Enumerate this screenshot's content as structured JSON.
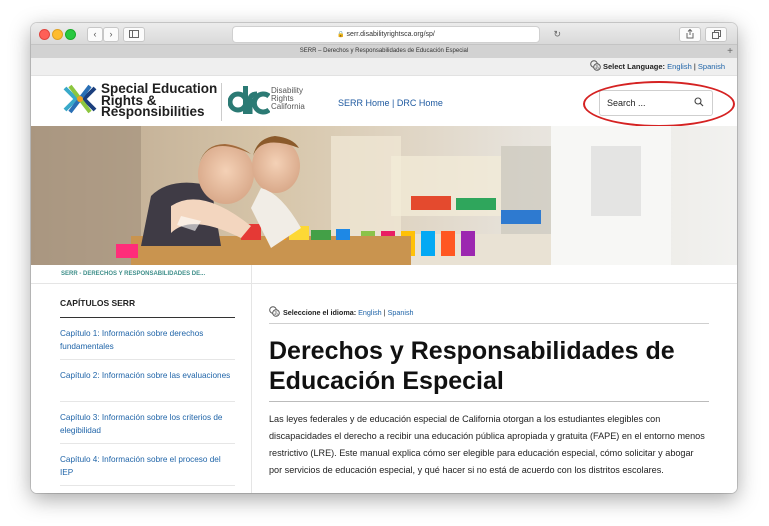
{
  "browser": {
    "url": "serr.disabilityrightsca.org/sp/",
    "tab_title": "SERR – Derechos y Responsabilidades de Educación Especial",
    "colors": {
      "close": "#fe5f57",
      "minimize": "#febc2e",
      "zoom": "#28c840"
    }
  },
  "lang_bar": {
    "label": "Select Language:",
    "english": "English",
    "sep": "|",
    "spanish": "Spanish"
  },
  "header": {
    "logo_line1": "Special Education",
    "logo_line2": "Rights &",
    "logo_line3": "Responsibilities",
    "drc_line1": "Disability",
    "drc_line2": "Rights",
    "drc_line3": "California",
    "nav_serr_home": "SERR Home",
    "nav_sep": "|",
    "nav_drc_home": "DRC Home",
    "search_placeholder": "Search ..."
  },
  "breadcrumb": "SERR - DERECHOS Y RESPONSABILIDADES DE...",
  "sidebar": {
    "title": "CAPÍTULOS SERR",
    "items": [
      {
        "label": "Capítulo 1: Información sobre derechos fundamentales"
      },
      {
        "label": "Capítulo 2: Información sobre las evaluaciones"
      },
      {
        "label": "Capítulo 3: Información sobre los criterios de elegibilidad"
      },
      {
        "label": "Capítulo 4: Información sobre el proceso del IEP"
      }
    ]
  },
  "main": {
    "lang_label": "Seleccione el idioma:",
    "lang_english": "English",
    "lang_sep": "|",
    "lang_spanish": "Spanish",
    "title": "Derechos y Responsabilidades de Educación Especial",
    "paragraph": "Las leyes federales y de educación especial de California otorgan a los estudiantes elegibles con discapacidades el derecho a recibir una educación pública apropiada y gratuita (FAPE) en el entorno menos restrictivo (LRE). Este manual explica cómo ser elegible para educación especial, cómo solicitar y abogar por servicios de educación especial, y qué hacer si no está de acuerdo con los distritos escolares."
  },
  "accent_colors": {
    "link": "#1f64a8",
    "highlight_oval": "#d52222",
    "breadcrumb": "#3f8f8a"
  }
}
